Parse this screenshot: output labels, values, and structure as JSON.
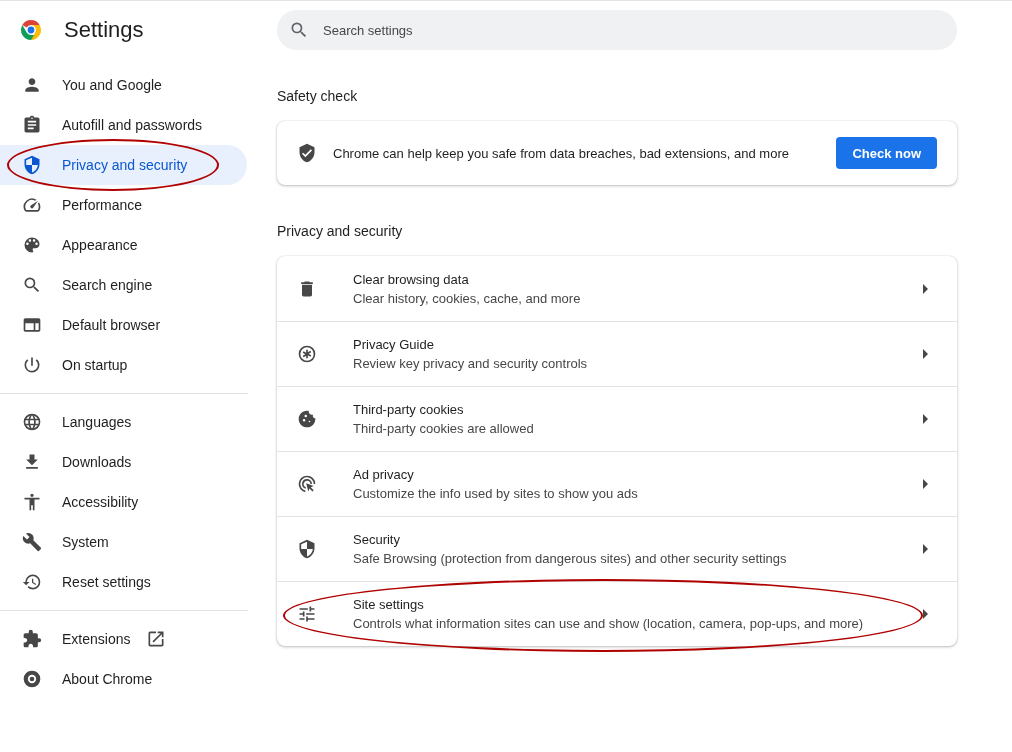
{
  "header": {
    "title": "Settings"
  },
  "search": {
    "placeholder": "Search settings"
  },
  "sidebar": {
    "groups": [
      {
        "items": [
          {
            "label": "You and Google",
            "selected": false,
            "circled": false,
            "external": false
          },
          {
            "label": "Autofill and passwords",
            "selected": false,
            "circled": false,
            "external": false
          },
          {
            "label": "Privacy and security",
            "selected": true,
            "circled": true,
            "external": false
          },
          {
            "label": "Performance",
            "selected": false,
            "circled": false,
            "external": false
          },
          {
            "label": "Appearance",
            "selected": false,
            "circled": false,
            "external": false
          },
          {
            "label": "Search engine",
            "selected": false,
            "circled": false,
            "external": false
          },
          {
            "label": "Default browser",
            "selected": false,
            "circled": false,
            "external": false
          },
          {
            "label": "On startup",
            "selected": false,
            "circled": false,
            "external": false
          }
        ]
      },
      {
        "items": [
          {
            "label": "Languages",
            "selected": false,
            "circled": false,
            "external": false
          },
          {
            "label": "Downloads",
            "selected": false,
            "circled": false,
            "external": false
          },
          {
            "label": "Accessibility",
            "selected": false,
            "circled": false,
            "external": false
          },
          {
            "label": "System",
            "selected": false,
            "circled": false,
            "external": false
          },
          {
            "label": "Reset settings",
            "selected": false,
            "circled": false,
            "external": false
          }
        ]
      },
      {
        "items": [
          {
            "label": "Extensions",
            "selected": false,
            "circled": false,
            "external": true
          },
          {
            "label": "About Chrome",
            "selected": false,
            "circled": false,
            "external": false
          }
        ]
      }
    ]
  },
  "safety_check": {
    "heading": "Safety check",
    "text": "Chrome can help keep you safe from data breaches, bad extensions, and more",
    "button": "Check now"
  },
  "privacy": {
    "heading": "Privacy and security",
    "rows": [
      {
        "title": "Clear browsing data",
        "subtitle": "Clear history, cookies, cache, and more",
        "circled": false
      },
      {
        "title": "Privacy Guide",
        "subtitle": "Review key privacy and security controls",
        "circled": false
      },
      {
        "title": "Third-party cookies",
        "subtitle": "Third-party cookies are allowed",
        "circled": false
      },
      {
        "title": "Ad privacy",
        "subtitle": "Customize the info used by sites to show you ads",
        "circled": false
      },
      {
        "title": "Security",
        "subtitle": "Safe Browsing (protection from dangerous sites) and other security settings",
        "circled": false
      },
      {
        "title": "Site settings",
        "subtitle": "Controls what information sites can use and show (location, camera, pop-ups, and more)",
        "circled": true
      }
    ]
  }
}
